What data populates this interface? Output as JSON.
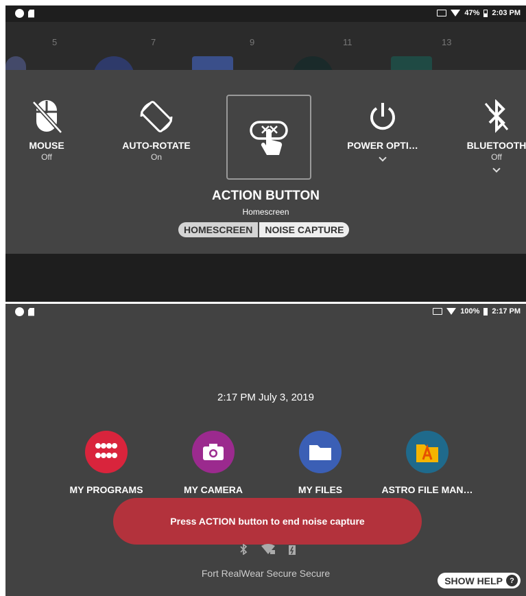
{
  "top": {
    "status": {
      "battery": "47%",
      "time": "2:03 PM"
    },
    "home_numbers": [
      "5",
      "7",
      "9",
      "11",
      "13"
    ],
    "tiles": [
      {
        "label": "MOUSE",
        "sub": "Off",
        "icon": "mouse-off-icon"
      },
      {
        "label": "AUTO-ROTATE",
        "sub": "On",
        "icon": "auto-rotate-icon"
      },
      {
        "label": "POWER OPTI…",
        "sub": "",
        "icon": "power-icon"
      },
      {
        "label": "BLUETOOTH",
        "sub": "Off",
        "icon": "bluetooth-off-icon"
      }
    ],
    "action": {
      "title": "ACTION BUTTON",
      "sub": "Homescreen",
      "icon": "hand-tap-icon"
    },
    "segment": [
      "HOMESCREEN",
      "NOISE CAPTURE"
    ]
  },
  "bottom": {
    "status": {
      "battery": "100%",
      "time": "2:17 PM"
    },
    "datetime": "2:17 PM July 3, 2019",
    "apps": [
      {
        "name": "MY PROGRAMS",
        "color": "#d9243c",
        "icon": "grid-dots-icon"
      },
      {
        "name": "MY CAMERA",
        "color": "#9b2a8e",
        "icon": "camera-icon"
      },
      {
        "name": "MY FILES",
        "color": "#3b5fb5",
        "icon": "folder-icon"
      },
      {
        "name": "ASTRO FILE MAN…",
        "color": "#1f6a8c",
        "icon": "astro-icon"
      }
    ],
    "toast": "Press ACTION button to end noise capture",
    "secure": "Fort RealWear Secure Secure",
    "help": "SHOW HELP"
  }
}
